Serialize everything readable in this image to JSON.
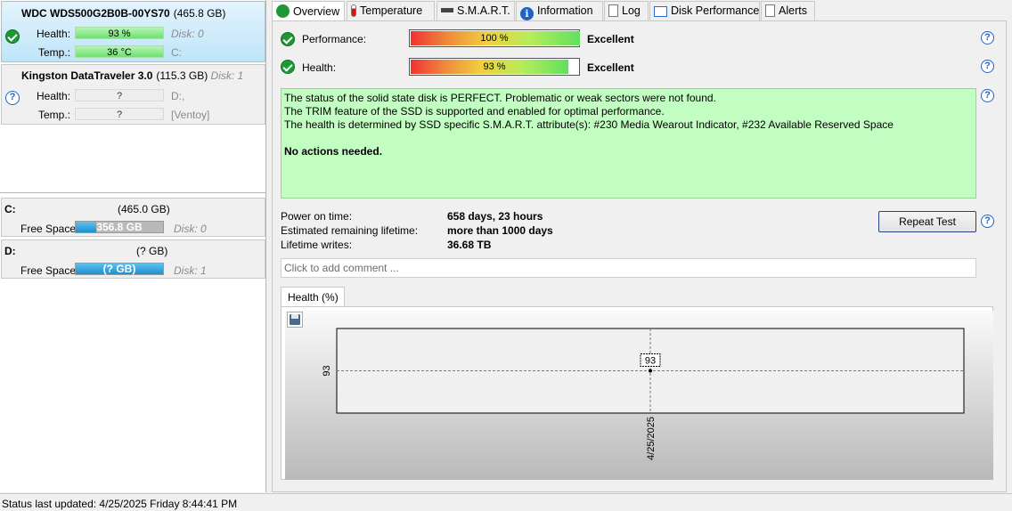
{
  "left": {
    "disks": [
      {
        "name": "WDC WDS500G2B0B-00YS70",
        "capacity": "(465.8 GB)",
        "disk_no": "",
        "health_label": "Health:",
        "health_value": "93 %",
        "health_right": "Disk: 0",
        "temp_label": "Temp.:",
        "temp_value": "36 °C",
        "temp_right": "C:"
      },
      {
        "name": "Kingston DataTraveler 3.0",
        "capacity": "(115.3 GB)",
        "disk_no": "Disk: 1",
        "health_label": "Health:",
        "health_value": "?",
        "health_right": "D:,",
        "temp_label": "Temp.:",
        "temp_value": "?",
        "temp_right": "[Ventoy]"
      }
    ],
    "volumes": [
      {
        "letter": "C:",
        "size": "(465.0 GB)",
        "free_label": "Free Space",
        "free_value": "356.8 GB",
        "free_fraction": 0.23,
        "disk": "Disk: 0"
      },
      {
        "letter": "D:",
        "size": "(? GB)",
        "free_label": "Free Space",
        "free_value": "(? GB)",
        "free_fraction": 1.0,
        "disk": "Disk: 1"
      }
    ]
  },
  "tabs": [
    {
      "label": "Overview",
      "icon": "ok-check-icon"
    },
    {
      "label": "Temperature",
      "icon": "thermometer-icon"
    },
    {
      "label": "S.M.A.R.T.",
      "icon": "drive-icon"
    },
    {
      "label": "Information",
      "icon": "info-icon"
    },
    {
      "label": "Log",
      "icon": "document-icon"
    },
    {
      "label": "Disk Performance",
      "icon": "performance-chart-icon"
    },
    {
      "label": "Alerts",
      "icon": "alerts-icon"
    }
  ],
  "overview": {
    "performance_label": "Performance:",
    "performance_value": "100 %",
    "performance_fraction": 1.0,
    "performance_rating": "Excellent",
    "health_label": "Health:",
    "health_value": "93 %",
    "health_fraction": 0.93,
    "health_rating": "Excellent",
    "status_lines": [
      "The status of the solid state disk is PERFECT. Problematic or weak sectors were not found.",
      "The TRIM feature of the SSD is supported and enabled for optimal performance.",
      "The health is determined by SSD specific S.M.A.R.T. attribute(s):  #230 Media Wearout Indicator, #232 Available Reserved Space"
    ],
    "status_action": "No actions needed.",
    "power_on_label": "Power on time:",
    "power_on_value": "658 days, 23 hours",
    "lifetime_label": "Estimated remaining lifetime:",
    "lifetime_value": "more than 1000 days",
    "writes_label": "Lifetime writes:",
    "writes_value": "36.68 TB",
    "repeat_button": "Repeat Test",
    "comment_placeholder": "Click to add comment ...",
    "chart_tab": "Health (%)"
  },
  "chart_data": {
    "type": "scatter",
    "title": "Health (%)",
    "x": [
      "4/25/2025"
    ],
    "values": [
      93
    ],
    "y_tick_labels": [
      "93"
    ],
    "x_tick_labels": [
      "4/25/2025"
    ],
    "data_labels": [
      "93"
    ],
    "grid": true
  },
  "statusbar": {
    "text": "Status last updated: 4/25/2025 Friday 8:44:41 PM"
  },
  "colors": {
    "ok_green": "#1b9a33",
    "status_bg": "#c2fdc2",
    "selection": "#bfe5f9",
    "link_blue": "#1f62c4"
  }
}
